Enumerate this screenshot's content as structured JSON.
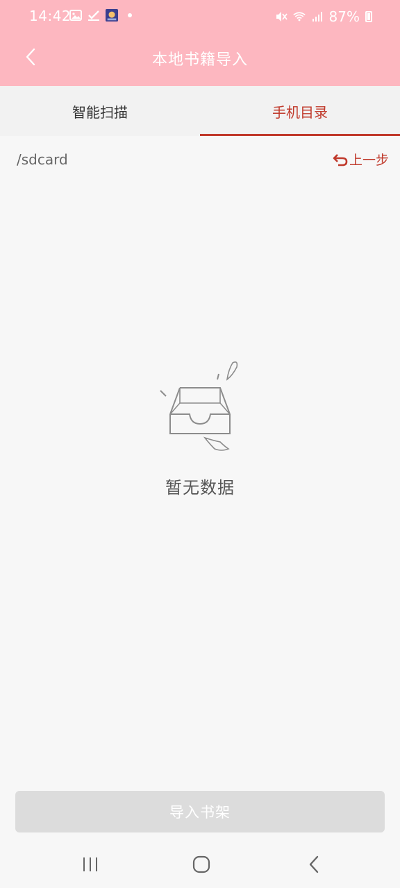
{
  "status_bar": {
    "time": "14:42",
    "battery": "87%",
    "icons_left": [
      "gallery-icon",
      "check-icon",
      "avatar-app-icon",
      "dot-icon"
    ],
    "icons_right": [
      "mute-icon",
      "wifi-icon",
      "signal-icon",
      "battery-icon"
    ]
  },
  "header": {
    "title": "本地书籍导入",
    "back_icon": "chevron-left-icon"
  },
  "tabs": [
    {
      "label": "智能扫描",
      "active": false
    },
    {
      "label": "手机目录",
      "active": true
    }
  ],
  "path": {
    "current": "/sdcard",
    "prev_label": "上一步",
    "prev_icon": "undo-icon"
  },
  "empty_state": {
    "icon": "empty-box-icon",
    "text": "暂无数据"
  },
  "import_button": {
    "label": "导入书架"
  },
  "nav_bar": {
    "items": [
      "recent-apps-icon",
      "home-icon",
      "back-icon"
    ]
  },
  "colors": {
    "header_bg": "#fdb7c0",
    "accent": "#c0392b",
    "disabled_button": "#dcdcdc",
    "background": "#f7f7f7"
  }
}
